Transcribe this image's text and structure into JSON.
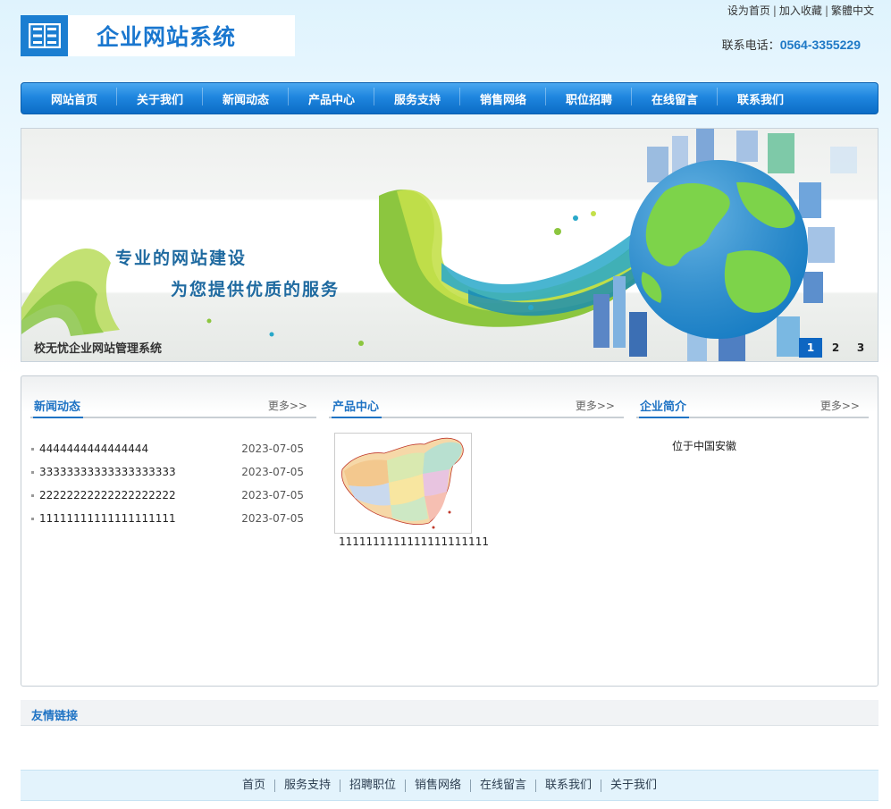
{
  "top_links": [
    "设为首页",
    "加入收藏",
    "繁體中文"
  ],
  "logo": {
    "text": "企业网站系统"
  },
  "contact": {
    "label": "联系电话：",
    "phone": "0564-3355229"
  },
  "nav": [
    "网站首页",
    "关于我们",
    "新闻动态",
    "产品中心",
    "服务支持",
    "销售网络",
    "职位招聘",
    "在线留言",
    "联系我们"
  ],
  "banner": {
    "slogan_1": "专业的网站建设",
    "slogan_2": "为您提供优质的服务",
    "caption": "校无忧企业网站管理系统",
    "pages": [
      "1",
      "2",
      "3"
    ],
    "active_page": "1"
  },
  "news": {
    "title": "新闻动态",
    "more": "更多>>",
    "items": [
      {
        "title": "4444444444444444",
        "date": "2023-07-05"
      },
      {
        "title": "33333333333333333333",
        "date": "2023-07-05"
      },
      {
        "title": "22222222222222222222",
        "date": "2023-07-05"
      },
      {
        "title": "11111111111111111111",
        "date": "2023-07-05"
      }
    ]
  },
  "products": {
    "title": "产品中心",
    "more": "更多>>",
    "items": [
      {
        "name": "1111111111111111111111"
      }
    ]
  },
  "about": {
    "title": "企业简介",
    "more": "更多>>",
    "text": "位于中国安徽"
  },
  "friend_links": {
    "title": "友情链接"
  },
  "footer": [
    "首页",
    "服务支持",
    "招聘职位",
    "销售网络",
    "在线留言",
    "联系我们",
    "关于我们"
  ]
}
